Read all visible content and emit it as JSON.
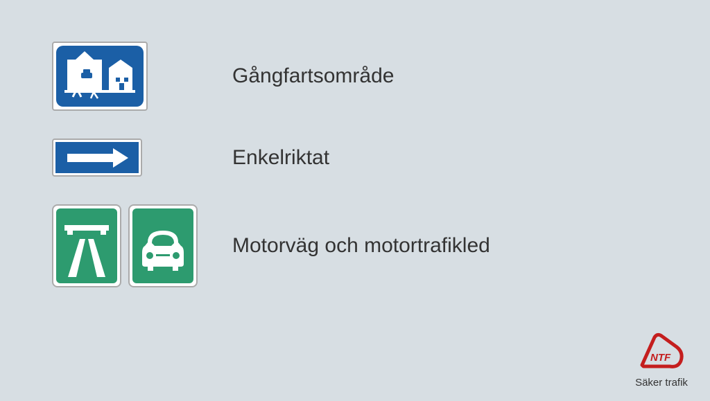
{
  "rows": [
    {
      "label": "Gångfartsområde"
    },
    {
      "label": "Enkelriktat"
    },
    {
      "label": "Motorväg och motortrafikled"
    }
  ],
  "logo": {
    "text": "NTF",
    "tagline": "Säker trafik"
  }
}
